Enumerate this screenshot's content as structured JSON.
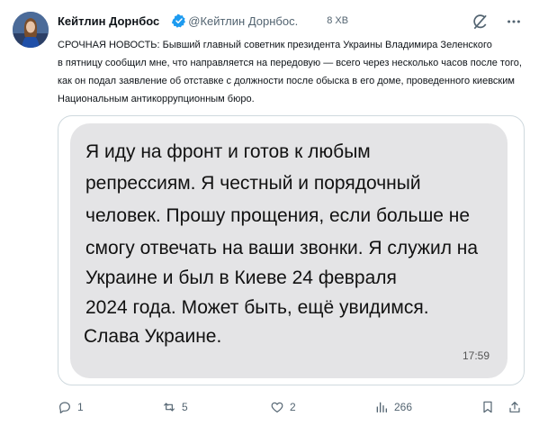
{
  "author": {
    "name": "Кейтлин Дорнбос",
    "handle": "@Кейтлин Дорнбос.",
    "time": "8 ХВ"
  },
  "tweet": {
    "lines": [
      "СРОЧНАЯ НОВОСТЬ: Бывший главный советник президента Украины Владимира Зеленского",
      "в пятницу сообщил мне, что направляется на передовую — всего через несколько часов после того,",
      "как он подал заявление об отставке с должности после обыска в его доме, проведенного киевским",
      "Национальным антикоррупционным бюро."
    ]
  },
  "message": {
    "lines": [
      "Я иду на фронт и готов к любым",
      "репрессиям. Я честный и порядочный",
      "человек. Прошу прощения, если больше не",
      "смогу отвечать на ваши звонки. Я служил на",
      "Украине и был в Киеве 24 февраля",
      "2024 года. Может быть, ещё увидимся.",
      "Слава Украине."
    ],
    "time": "17:59"
  },
  "actions": {
    "replies": "1",
    "reposts": "5",
    "likes": "2",
    "views": "266"
  },
  "icons": {
    "verified": "verified-badge-icon",
    "grok": "grok-icon",
    "more": "more-icon",
    "reply": "reply-icon",
    "repost": "repost-icon",
    "like": "heart-icon",
    "views": "views-chart-icon",
    "bookmark": "bookmark-icon",
    "share": "share-icon"
  },
  "colors": {
    "verified": "#1d9bf0",
    "muted": "#536471",
    "bubble": "#e4e4e6",
    "avatar_dress": "#1f4fa8"
  }
}
